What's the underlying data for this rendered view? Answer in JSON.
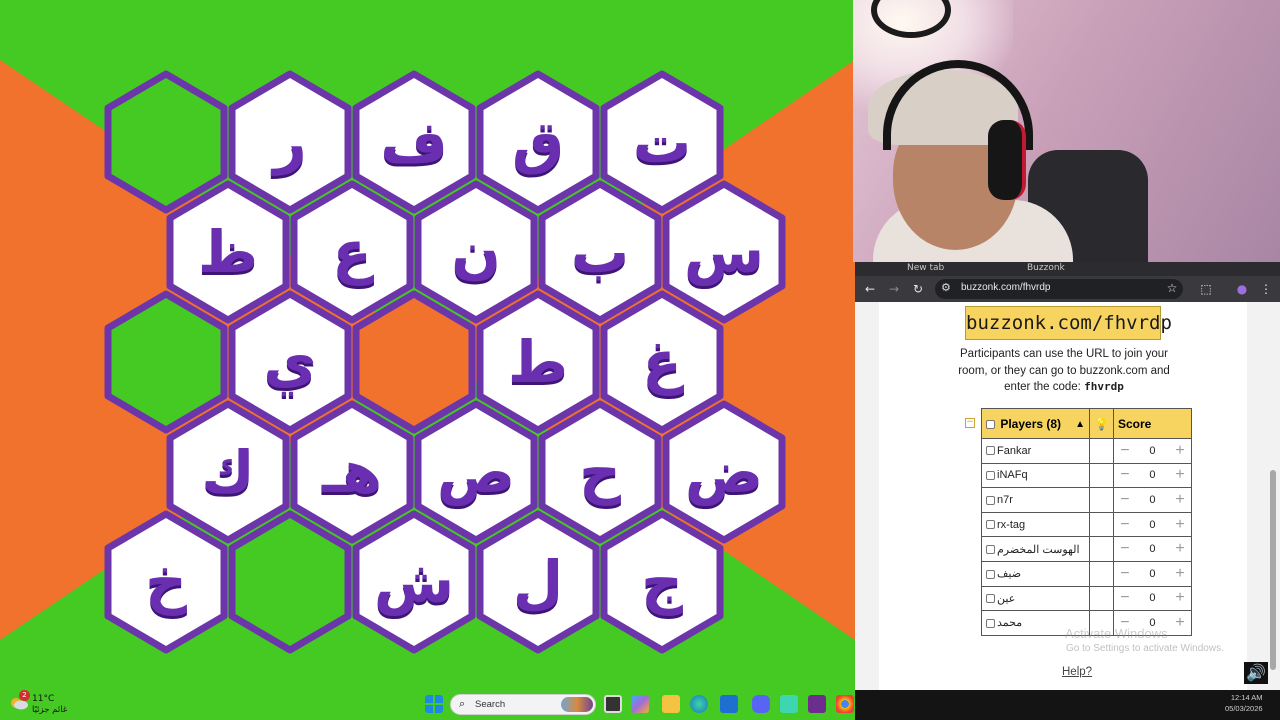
{
  "board": {
    "colors": {
      "green": "#45c923",
      "orange": "#f0722d",
      "purple": "#6d35aa",
      "white": "#ffffff"
    },
    "cells": [
      {
        "row": 0,
        "col": 0,
        "letter": "",
        "state": "green"
      },
      {
        "row": 0,
        "col": 1,
        "letter": "ر",
        "state": "open"
      },
      {
        "row": 0,
        "col": 2,
        "letter": "ف",
        "state": "open"
      },
      {
        "row": 0,
        "col": 3,
        "letter": "ق",
        "state": "open"
      },
      {
        "row": 0,
        "col": 4,
        "letter": "ت",
        "state": "open"
      },
      {
        "row": 1,
        "col": 0,
        "letter": "ظ",
        "state": "open"
      },
      {
        "row": 1,
        "col": 1,
        "letter": "ع",
        "state": "open"
      },
      {
        "row": 1,
        "col": 2,
        "letter": "ن",
        "state": "open"
      },
      {
        "row": 1,
        "col": 3,
        "letter": "ب",
        "state": "open"
      },
      {
        "row": 1,
        "col": 4,
        "letter": "س",
        "state": "open"
      },
      {
        "row": 2,
        "col": 0,
        "letter": "",
        "state": "green"
      },
      {
        "row": 2,
        "col": 1,
        "letter": "ي",
        "state": "open"
      },
      {
        "row": 2,
        "col": 2,
        "letter": "",
        "state": "orange"
      },
      {
        "row": 2,
        "col": 3,
        "letter": "ط",
        "state": "open"
      },
      {
        "row": 2,
        "col": 4,
        "letter": "غ",
        "state": "open"
      },
      {
        "row": 3,
        "col": 0,
        "letter": "ك",
        "state": "open"
      },
      {
        "row": 3,
        "col": 1,
        "letter": "هـ",
        "state": "open"
      },
      {
        "row": 3,
        "col": 2,
        "letter": "ص",
        "state": "open"
      },
      {
        "row": 3,
        "col": 3,
        "letter": "ح",
        "state": "open"
      },
      {
        "row": 3,
        "col": 4,
        "letter": "ض",
        "state": "open"
      },
      {
        "row": 4,
        "col": 0,
        "letter": "خ",
        "state": "open"
      },
      {
        "row": 4,
        "col": 1,
        "letter": "",
        "state": "green"
      },
      {
        "row": 4,
        "col": 2,
        "letter": "ش",
        "state": "open"
      },
      {
        "row": 4,
        "col": 3,
        "letter": "ل",
        "state": "open"
      },
      {
        "row": 4,
        "col": 4,
        "letter": "ج",
        "state": "open"
      }
    ]
  },
  "browser": {
    "tabs": [
      "New tab",
      "Buzzonk"
    ],
    "url": "buzzonk.com/fhvrdp",
    "room_url": "buzzonk.com/fhvrdp",
    "join_line1": "Participants can use the URL to join your",
    "join_line2": "room, or they can go to buzzonk.com and",
    "join_line3_prefix": "enter the code: ",
    "join_code": "fhvrdp",
    "players_header": "Players (8)",
    "score_header": "Score",
    "players": [
      {
        "name": "Fankar",
        "score": "0"
      },
      {
        "name": "iNAFq",
        "score": "0"
      },
      {
        "name": "n7r",
        "score": "0"
      },
      {
        "name": "rx-tag",
        "score": "0"
      },
      {
        "name": "الهوست المخضرم",
        "score": "0"
      },
      {
        "name": "ضيف",
        "score": "0"
      },
      {
        "name": "عين",
        "score": "0"
      },
      {
        "name": "محمد",
        "score": "0"
      }
    ],
    "help_link": "Help?",
    "activate_title": "Activate Windows",
    "activate_sub": "Go to Settings to activate Windows."
  },
  "taskbar": {
    "weather_temp": "11°C",
    "weather_cond": "غائم جزئيًا",
    "weather_badge": "2",
    "search_placeholder": "Search",
    "clock_time": "12:14 AM",
    "clock_date": "05/03/2026"
  }
}
